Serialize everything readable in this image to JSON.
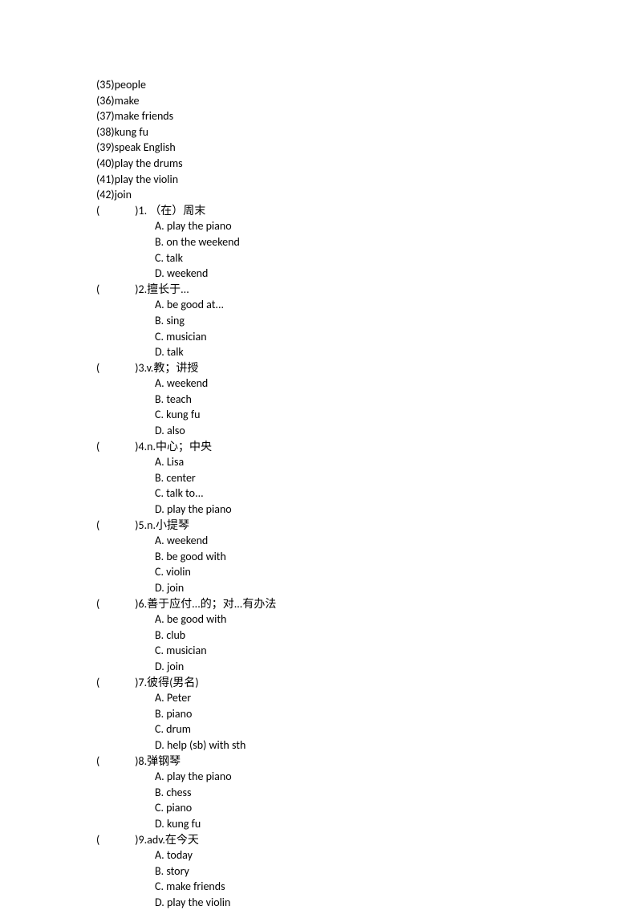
{
  "top_items": [
    "(35)people",
    "(36)make",
    "(37)make friends",
    "(38)kung fu",
    "(39)speak English",
    "(40)play the drums",
    "(41)play the violin",
    "(42)join"
  ],
  "questions": [
    {
      "num": "1.",
      "prompt": "（在）周末",
      "options": [
        "A. play the piano",
        "B. on the weekend",
        "C. talk",
        "D. weekend"
      ]
    },
    {
      "num": "2.",
      "prompt": "擅长于...",
      "options": [
        "A. be good at...",
        "B. sing",
        "C. musician",
        "D. talk"
      ]
    },
    {
      "num": "3.",
      "prompt": "v.教；讲授",
      "options": [
        "A. weekend",
        "B. teach",
        "C. kung fu",
        "D. also"
      ]
    },
    {
      "num": "4.",
      "prompt": "n.中心；中央",
      "options": [
        "A. Lisa",
        "B. center",
        "C. talk to...",
        "D. play the piano"
      ]
    },
    {
      "num": "5.",
      "prompt": "n.小提琴",
      "options": [
        "A. weekend",
        "B. be good with",
        "C. violin",
        "D. join"
      ]
    },
    {
      "num": "6.",
      "prompt": "善于应付...的；对...有办法",
      "options": [
        "A. be good with",
        "B. club",
        "C. musician",
        "D. join"
      ]
    },
    {
      "num": "7.",
      "prompt": "彼得(男名)",
      "options": [
        "A. Peter",
        "B. piano",
        "C. drum",
        "D. help (sb) with sth"
      ]
    },
    {
      "num": "8.",
      "prompt": "弹钢琴",
      "options": [
        "A. play the piano",
        "B. chess",
        "C. piano",
        "D. kung fu"
      ]
    },
    {
      "num": "9.",
      "prompt": "adv.在今天",
      "options": [
        "A. today",
        "B. story",
        "C. make friends",
        "D. play the violin"
      ]
    }
  ],
  "paren_open": "(",
  "paren_close": ")"
}
